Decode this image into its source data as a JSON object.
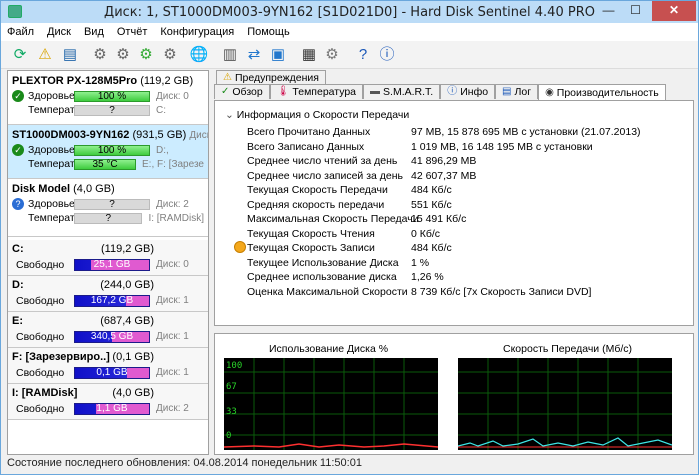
{
  "window": {
    "title": "Диск: 1, ST1000DM003-9YN162 [S1D021D0]  -  Hard Disk Sentinel 4.40 PRO",
    "minimize": "—",
    "maximize": "☐",
    "close": "✕"
  },
  "menu": [
    "Файл",
    "Диск",
    "Вид",
    "Отчёт",
    "Конфигурация",
    "Помощь"
  ],
  "disks": [
    {
      "name": "PLEXTOR PX-128M5Pro",
      "size": "(119,2 GB)",
      "health_label": "Здоровье:",
      "health": "100 %",
      "health_extra": "Диск: 0",
      "temp_label": "Температура:",
      "temp": "?",
      "temp_extra": "C:"
    },
    {
      "name": "ST1000DM003-9YN162",
      "size": "(931,5 GB)",
      "disk_no": "Диск: 1",
      "health_label": "Здоровье:",
      "health": "100 %",
      "health_extra": "D:,",
      "temp_label": "Температура:",
      "temp": "35 °C",
      "temp_extra": "E:, F: [Зарезе"
    },
    {
      "name": "Disk Model",
      "size": "(4,0 GB)",
      "health_label": "Здоровье:",
      "health": "?",
      "health_extra": "Диск: 2",
      "temp_label": "Температура:",
      "temp": "?",
      "temp_extra": "I: [RAMDisk]"
    }
  ],
  "partitions": [
    {
      "name": "C:",
      "size": "(119,2 GB)",
      "free_label": "Свободно",
      "free": "25,1 GB",
      "used_fraction": 0.79,
      "disk": "Диск: 0"
    },
    {
      "name": "D:",
      "size": "(244,0 GB)",
      "free_label": "Свободно",
      "free": "167,2 GB",
      "used_fraction": 0.31,
      "disk": "Диск: 1"
    },
    {
      "name": "E:",
      "size": "(687,4 GB)",
      "free_label": "Свободно",
      "free": "340,5 GB",
      "used_fraction": 0.5,
      "disk": "Диск: 1"
    },
    {
      "name": "F: [Зарезервиро..]",
      "size": "(0,1 GB)",
      "free_label": "Свободно",
      "free": "0,1 GB",
      "used_fraction": 0.3,
      "disk": "Диск: 1"
    },
    {
      "name": "I: [RAMDisk]",
      "size": "(4,0 GB)",
      "free_label": "Свободно",
      "free": "1,1 GB",
      "used_fraction": 0.72,
      "disk": "Диск: 2"
    }
  ],
  "tabs_top": [
    "Предупреждения"
  ],
  "tabs": [
    "Обзор",
    "Температура",
    "S.M.A.R.T.",
    "Инфо",
    "Лог",
    "Производительность"
  ],
  "perf": {
    "section_title": "Информация о Скорости Передачи",
    "rows": [
      {
        "label": "Всего Прочитано Данных",
        "value": "97 MB,  15 878 695 MB с установки  (21.07.2013)"
      },
      {
        "label": "Всего Записано Данных",
        "value": "1 019 MB,  16 148 195 MB с установки"
      },
      {
        "label": "Среднее число чтений за день",
        "value": "41 896,29 MB"
      },
      {
        "label": "Среднее число записей за день",
        "value": "42 607,37 MB"
      },
      {
        "label": "Текущая Скорость Передачи",
        "value": "484 Кб/с"
      },
      {
        "label": "Средняя скорость передачи",
        "value": "551 Кб/с"
      },
      {
        "label": "Максимальная Скорость Передачи",
        "value": "15 491 Кб/с"
      },
      {
        "label": "Текущая Скорость Чтения",
        "value": "0 Кб/с"
      },
      {
        "label": "Текущая Скорость Записи",
        "value": "484 Кб/с"
      },
      {
        "label": "Текущее Использование Диска",
        "value": "1 %"
      },
      {
        "label": "Среднее использование диска",
        "value": "1,26 %"
      },
      {
        "label": "Оценка Максимальной Скорости",
        "value": "8 739 Кб/с [7x Скорость Записи DVD]"
      }
    ]
  },
  "graphs": {
    "usage_title": "Использование Диска %",
    "speed_title": "Скорость Передачи (Мб/с)",
    "ticks": [
      "100",
      "67",
      "33",
      "0"
    ]
  },
  "status": "Состояние последнего обновления: 04.08.2014 понедельник 11:50:01"
}
